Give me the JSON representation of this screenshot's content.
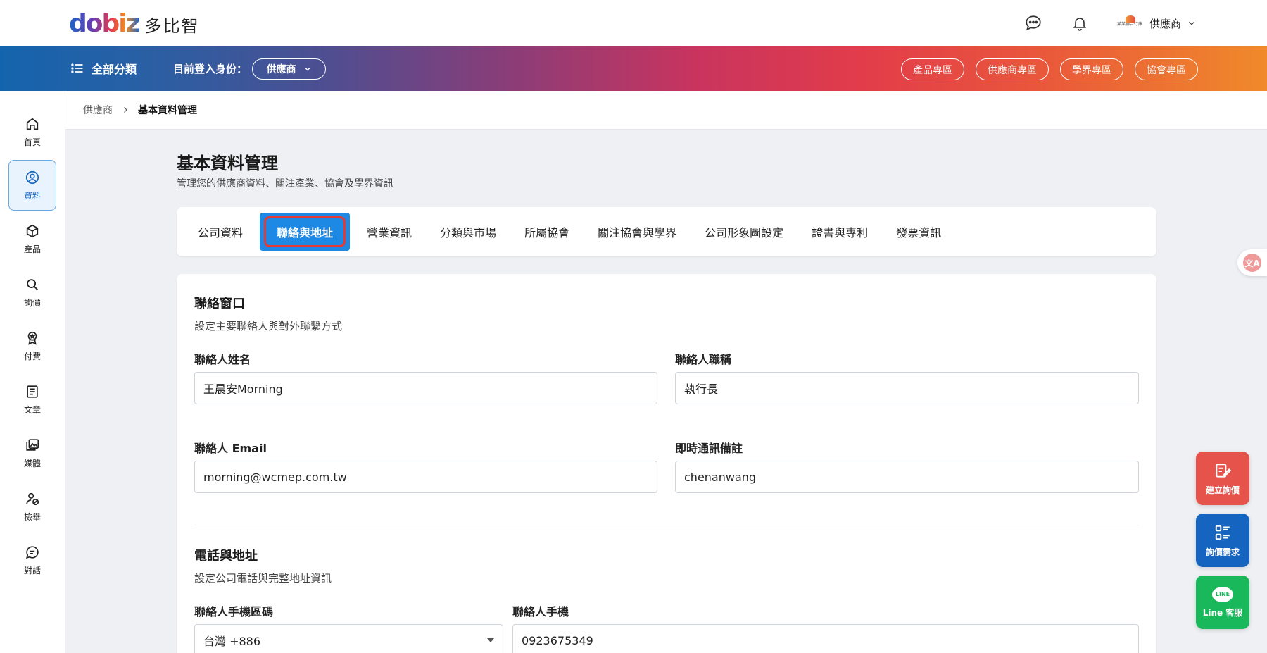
{
  "brand": {
    "mark": "dobiz",
    "name": "多比智"
  },
  "header": {
    "user_company": "某某聯合行庫",
    "user_role": "供應商"
  },
  "nav": {
    "all_categories": "全部分類",
    "login_as_label": "目前登入身份：",
    "role_value": "供應商",
    "zones": [
      "產品專區",
      "供應商專區",
      "學界專區",
      "協會專區"
    ]
  },
  "sidebar": {
    "items": [
      {
        "label": "首頁",
        "icon": "home-icon"
      },
      {
        "label": "資料",
        "icon": "user-circle-icon"
      },
      {
        "label": "產品",
        "icon": "box-icon"
      },
      {
        "label": "詢價",
        "icon": "search-icon"
      },
      {
        "label": "付費",
        "icon": "badge-icon"
      },
      {
        "label": "文章",
        "icon": "article-icon"
      },
      {
        "label": "媒體",
        "icon": "media-icon"
      },
      {
        "label": "檢舉",
        "icon": "report-icon"
      },
      {
        "label": "對話",
        "icon": "chat-icon"
      }
    ]
  },
  "breadcrumb": {
    "parent": "供應商",
    "current": "基本資料管理"
  },
  "page": {
    "title": "基本資料管理",
    "subtitle": "管理您的供應商資料、關注產業、協會及學界資訊"
  },
  "tabs": [
    "公司資料",
    "聯絡與地址",
    "營業資訊",
    "分類與市場",
    "所屬協會",
    "關注協會與學界",
    "公司形象圖設定",
    "證書與專利",
    "發票資訊"
  ],
  "contact_section": {
    "title": "聯絡窗口",
    "subtitle": "設定主要聯絡人與對外聯繫方式",
    "name_label": "聯絡人姓名",
    "name_value": "王晨安Morning",
    "title_label": "聯絡人職稱",
    "title_value": "執行長",
    "email_label": "聯絡人 Email",
    "email_value": "morning@wcmep.com.tw",
    "im_label": "即時通訊備註",
    "im_value": "chenanwang"
  },
  "phone_section": {
    "title": "電話與地址",
    "subtitle": "設定公司電話與完整地址資訊",
    "mobile_code_label": "聯絡人手機區碼",
    "mobile_code_value": "台灣 +886",
    "mobile_label": "聯絡人手機",
    "mobile_value": "0923675349"
  },
  "fabs": {
    "create_inquiry": "建立詢價",
    "inquiry_needs": "詢價需求",
    "line_service": "Line 客服",
    "line_bubble": "LINE"
  },
  "colors": {
    "accent": "#1e88e5",
    "active_outline": "#e53935",
    "fab_red": "#e5534b",
    "fab_blue": "#1565c0",
    "fab_green": "#19b85a"
  }
}
